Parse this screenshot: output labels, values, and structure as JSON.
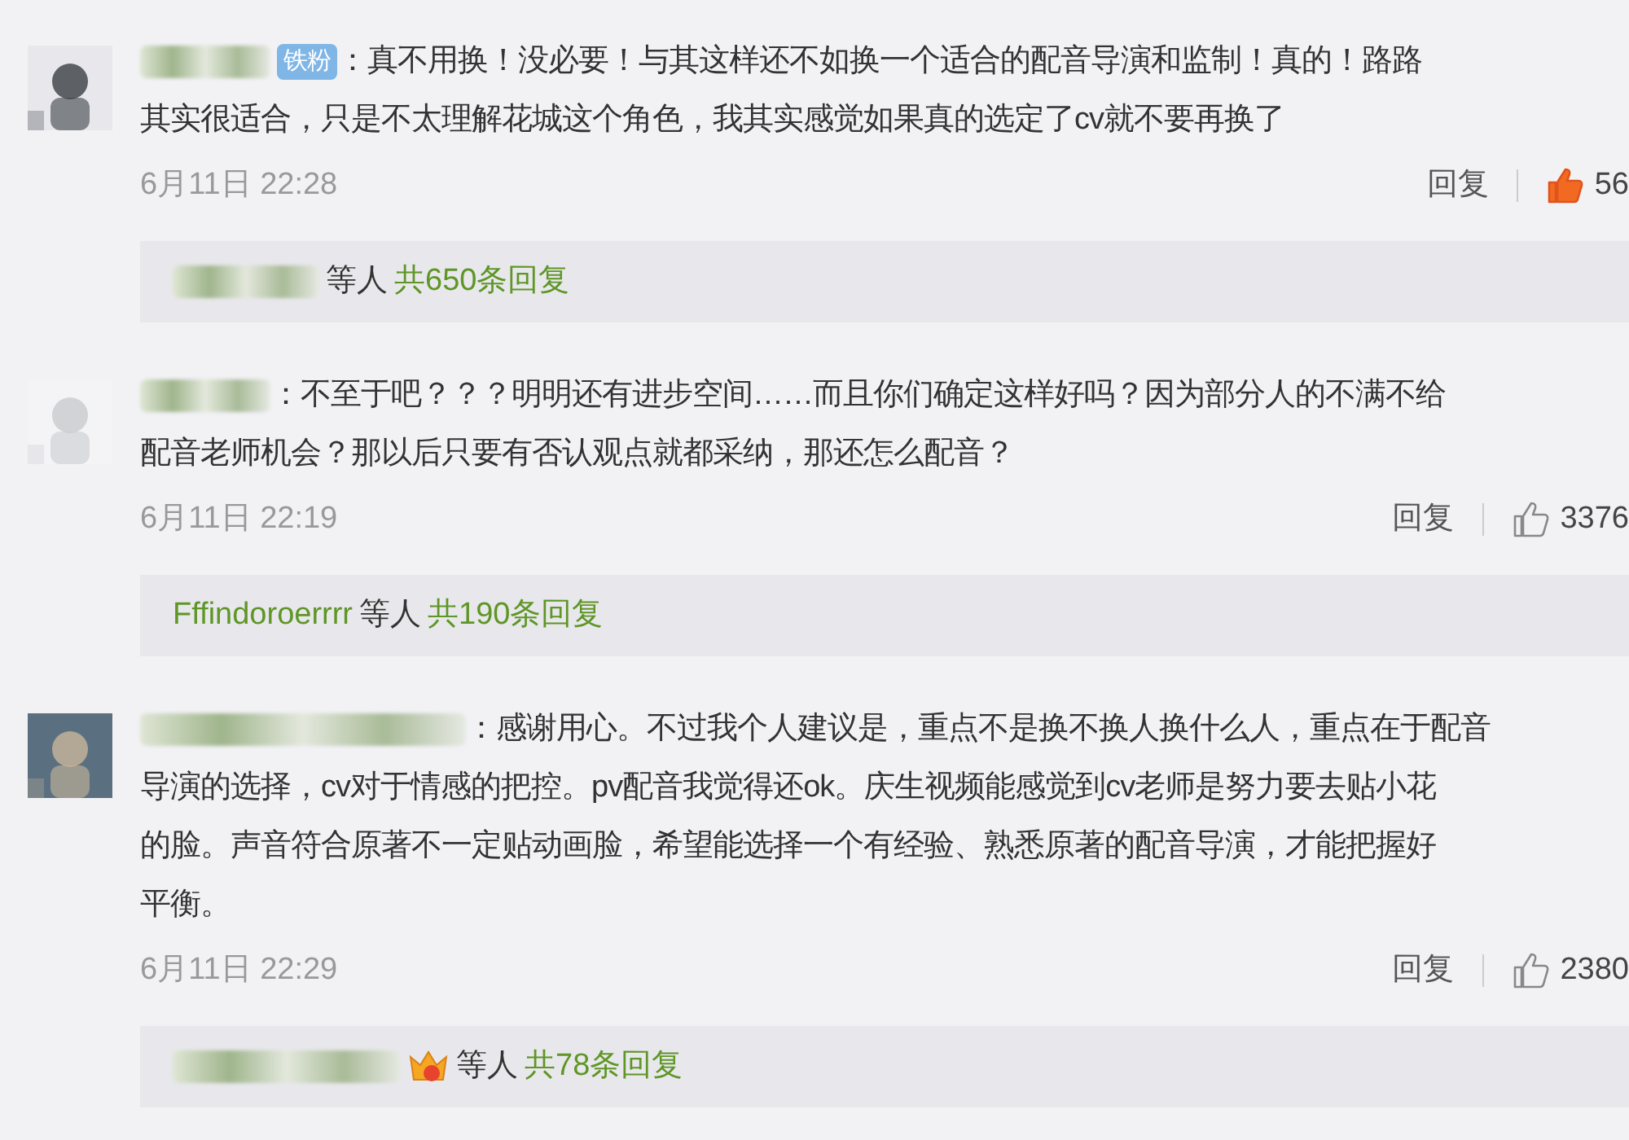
{
  "comments": [
    {
      "badge": "铁粉",
      "lines": [
        "：真不用换！没必要！与其这样还不如换一个适合的配音导演和监制！真的！路路",
        "其实很适合，只是不太理解花城这个角色，我其实感觉如果真的选定了cv就不要再换了"
      ],
      "date": "6月11日 22:28",
      "reply_label": "回复",
      "likes": "56",
      "liked": true,
      "replies": {
        "kind": "blurred",
        "crown": false,
        "suffix": "等人",
        "total": "共650条回复"
      }
    },
    {
      "lines": [
        "：不至于吧？？？明明还有进步空间……而且你们确定这样好吗？因为部分人的不满不给",
        "配音老师机会？那以后只要有否认观点就都采纳，那还怎么配音？"
      ],
      "date": "6月11日 22:19",
      "reply_label": "回复",
      "likes": "3376",
      "liked": false,
      "replies": {
        "kind": "name",
        "lead": "Fffindoroerrrr",
        "crown": false,
        "suffix": "等人",
        "total": "共190条回复"
      }
    },
    {
      "lines": [
        "：感谢用心。不过我个人建议是，重点不是换不换人换什么人，重点在于配音",
        "导演的选择，cv对于情感的把控。pv配音我觉得还ok。庆生视频能感觉到cv老师是努力要去贴小花",
        "的脸。声音符合原著不一定贴动画脸，希望能选择一个有经验、熟悉原著的配音导演，才能把握好",
        "平衡。"
      ],
      "date": "6月11日 22:29",
      "reply_label": "回复",
      "likes": "2380",
      "liked": false,
      "replies": {
        "kind": "blurred",
        "crown": true,
        "suffix": "等人",
        "total": "共78条回复"
      }
    }
  ]
}
